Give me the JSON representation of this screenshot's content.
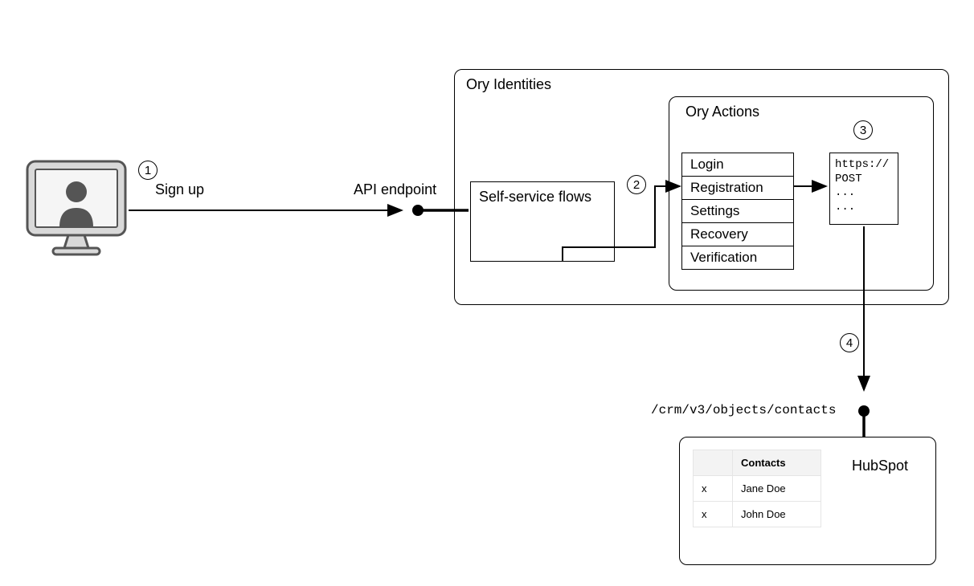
{
  "steps": {
    "s1": "1",
    "s2": "2",
    "s3": "3",
    "s4": "4"
  },
  "labels": {
    "signup": "Sign up",
    "api_endpoint": "API endpoint",
    "crm_path": "/crm/v3/objects/contacts"
  },
  "ory_identities": {
    "title": "Ory Identities",
    "self_service": "Self-service flows"
  },
  "ory_actions": {
    "title": "Ory Actions",
    "rows": {
      "login": "Login",
      "registration": "Registration",
      "settings": "Settings",
      "recovery": "Recovery",
      "verification": "Verification"
    },
    "code": "https://\nPOST\n...\n..."
  },
  "hubspot": {
    "title": "HubSpot",
    "table": {
      "header_blank": "",
      "header_contacts": "Contacts",
      "rows": {
        "r1_x": "x",
        "r1_name": "Jane Doe",
        "r2_x": "x",
        "r2_name": "John Doe"
      }
    }
  }
}
